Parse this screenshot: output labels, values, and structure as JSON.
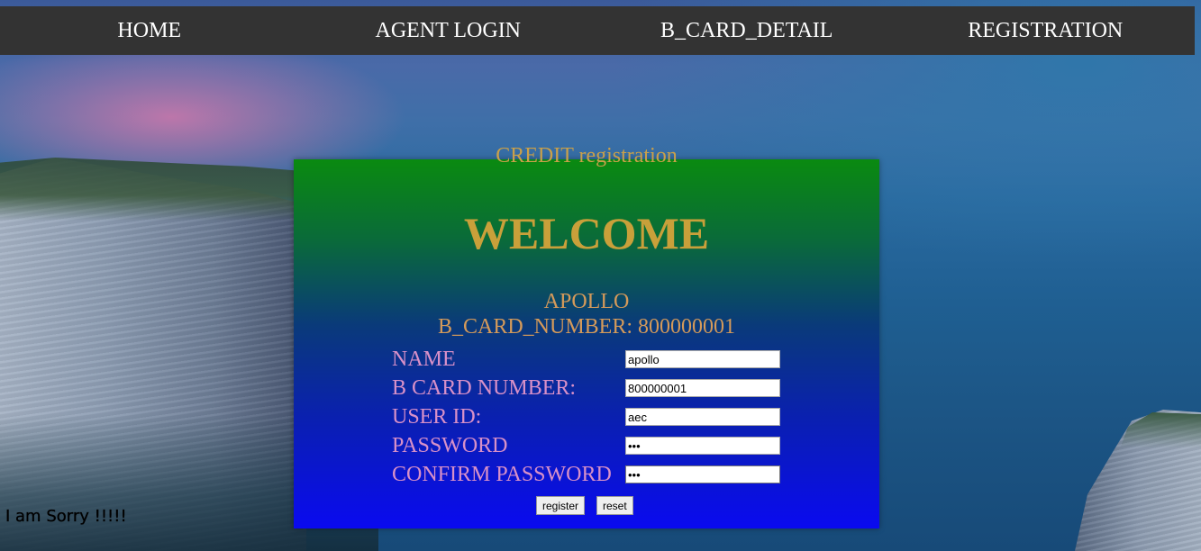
{
  "nav": {
    "items": [
      {
        "label": "HOME"
      },
      {
        "label": "AGENT LOGIN"
      },
      {
        "label": "B_CARD_DETAIL"
      },
      {
        "label": "REGISTRATION"
      }
    ]
  },
  "panel": {
    "caption": "CREDIT registration",
    "welcome": "WELCOME",
    "user_name": "APOLLO",
    "card_line": "B_CARD_NUMBER: 800000001"
  },
  "form": {
    "fields": [
      {
        "label": "NAME",
        "value": "apollo"
      },
      {
        "label": "B CARD NUMBER:",
        "value": "800000001"
      },
      {
        "label": "USER ID:",
        "value": "aec"
      },
      {
        "label": "PASSWORD",
        "value": "aec"
      },
      {
        "label": "CONFIRM PASSWORD",
        "value": "aec"
      }
    ],
    "register_label": "register",
    "reset_label": "reset"
  },
  "footer_message": "I am Sorry !!!!!",
  "colors": {
    "navbar": "#333333",
    "caption": "#c9a04a",
    "label": "#d890c8"
  }
}
